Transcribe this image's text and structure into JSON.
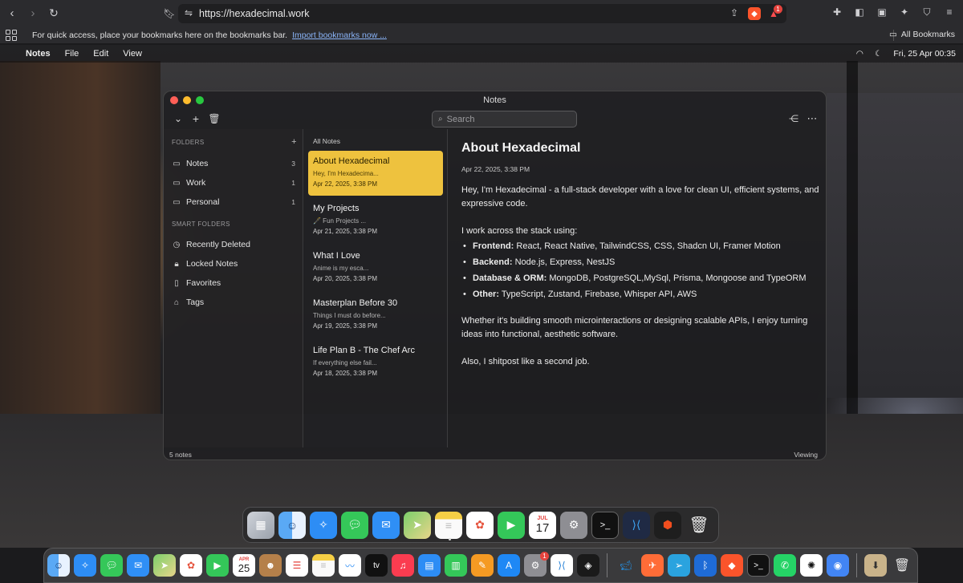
{
  "browser": {
    "url": "https://hexadecimal.work",
    "notification_badge": "1",
    "bookmarks_prompt": "For quick access, place your bookmarks here on the bookmarks bar.",
    "import_link": "Import bookmarks now ...",
    "all_bookmarks": "All Bookmarks"
  },
  "menubar": {
    "apple": "",
    "app_name": "Notes",
    "menus": [
      "File",
      "Edit",
      "View"
    ],
    "datetime": "Fri, 25 Apr 00:35"
  },
  "window": {
    "title": "Notes",
    "search_placeholder": "Search",
    "footer_count": "5 notes",
    "footer_mode": "Viewing"
  },
  "sidebar": {
    "folders_header": "FOLDERS",
    "folders": [
      {
        "label": "Notes",
        "count": "3",
        "icon": "folder-icon"
      },
      {
        "label": "Work",
        "count": "1",
        "icon": "folder-icon"
      },
      {
        "label": "Personal",
        "count": "1",
        "icon": "folder-icon"
      }
    ],
    "smart_header": "SMART FOLDERS",
    "smart": [
      {
        "label": "Recently Deleted",
        "icon": "clock-icon"
      },
      {
        "label": "Locked Notes",
        "icon": "lock-icon"
      },
      {
        "label": "Favorites",
        "icon": "bookmark-icon"
      },
      {
        "label": "Tags",
        "icon": "tag-icon"
      }
    ]
  },
  "note_list": {
    "header": "All Notes",
    "notes": [
      {
        "title": "About Hexadecimal",
        "preview": "Hey, I'm Hexadecima...",
        "date": "Apr 22, 2025, 3:38 PM",
        "selected": true
      },
      {
        "title": "My Projects",
        "preview": "🖋️ Fun Projects ...",
        "date": "Apr 21, 2025, 3:38 PM",
        "selected": false
      },
      {
        "title": "What I Love",
        "preview": "Anime is my esca...",
        "date": "Apr 20, 2025, 3:38 PM",
        "selected": false
      },
      {
        "title": "Masterplan Before 30",
        "preview": "Things I must do before...",
        "date": "Apr 19, 2025, 3:38 PM",
        "selected": false
      },
      {
        "title": "Life Plan B - The Chef Arc",
        "preview": "If everything else fail...",
        "date": "Apr 18, 2025, 3:38 PM",
        "selected": false
      }
    ]
  },
  "document": {
    "title": "About Hexadecimal",
    "date": "Apr 22, 2025, 3:38 PM",
    "intro": "Hey, I'm Hexadecimal - a full-stack developer with a love for clean UI, efficient systems, and expressive code.",
    "stack_intro": "I work across the stack using:",
    "stack": [
      {
        "label": "Frontend:",
        "value": " React, React Native, TailwindCSS, CSS, Shadcn UI, Framer Motion"
      },
      {
        "label": "Backend:",
        "value": " Node.js, Express, NestJS"
      },
      {
        "label": "Database & ORM:",
        "value": " MongoDB, PostgreSQL,MySql, Prisma, Mongoose and TypeORM"
      },
      {
        "label": "Other:",
        "value": " TypeScript, Zustand, Firebase, Whisper API, AWS"
      }
    ],
    "closing": "Whether it's building smooth microinteractions or designing scalable APIs, I enjoy turning ideas into functional, aesthetic software.",
    "signoff": "Also, I shitpost like a second job."
  },
  "dock": {
    "calendar_month": "JUL",
    "calendar_day": "17",
    "apps": [
      "launchpad",
      "finder",
      "safari",
      "messages",
      "mail",
      "maps",
      "notes",
      "photos",
      "facetime",
      "calendar",
      "settings",
      "terminal",
      "vscode",
      "figma",
      "trash"
    ]
  },
  "host_dock": {
    "calendar_month": "APR",
    "calendar_day": "25",
    "settings_badge": "1",
    "tv_label": "tv"
  },
  "colors": {
    "accent": "#eec23e",
    "traffic_red": "#ff5f57",
    "traffic_yellow": "#febc2e",
    "traffic_green": "#28c840"
  }
}
